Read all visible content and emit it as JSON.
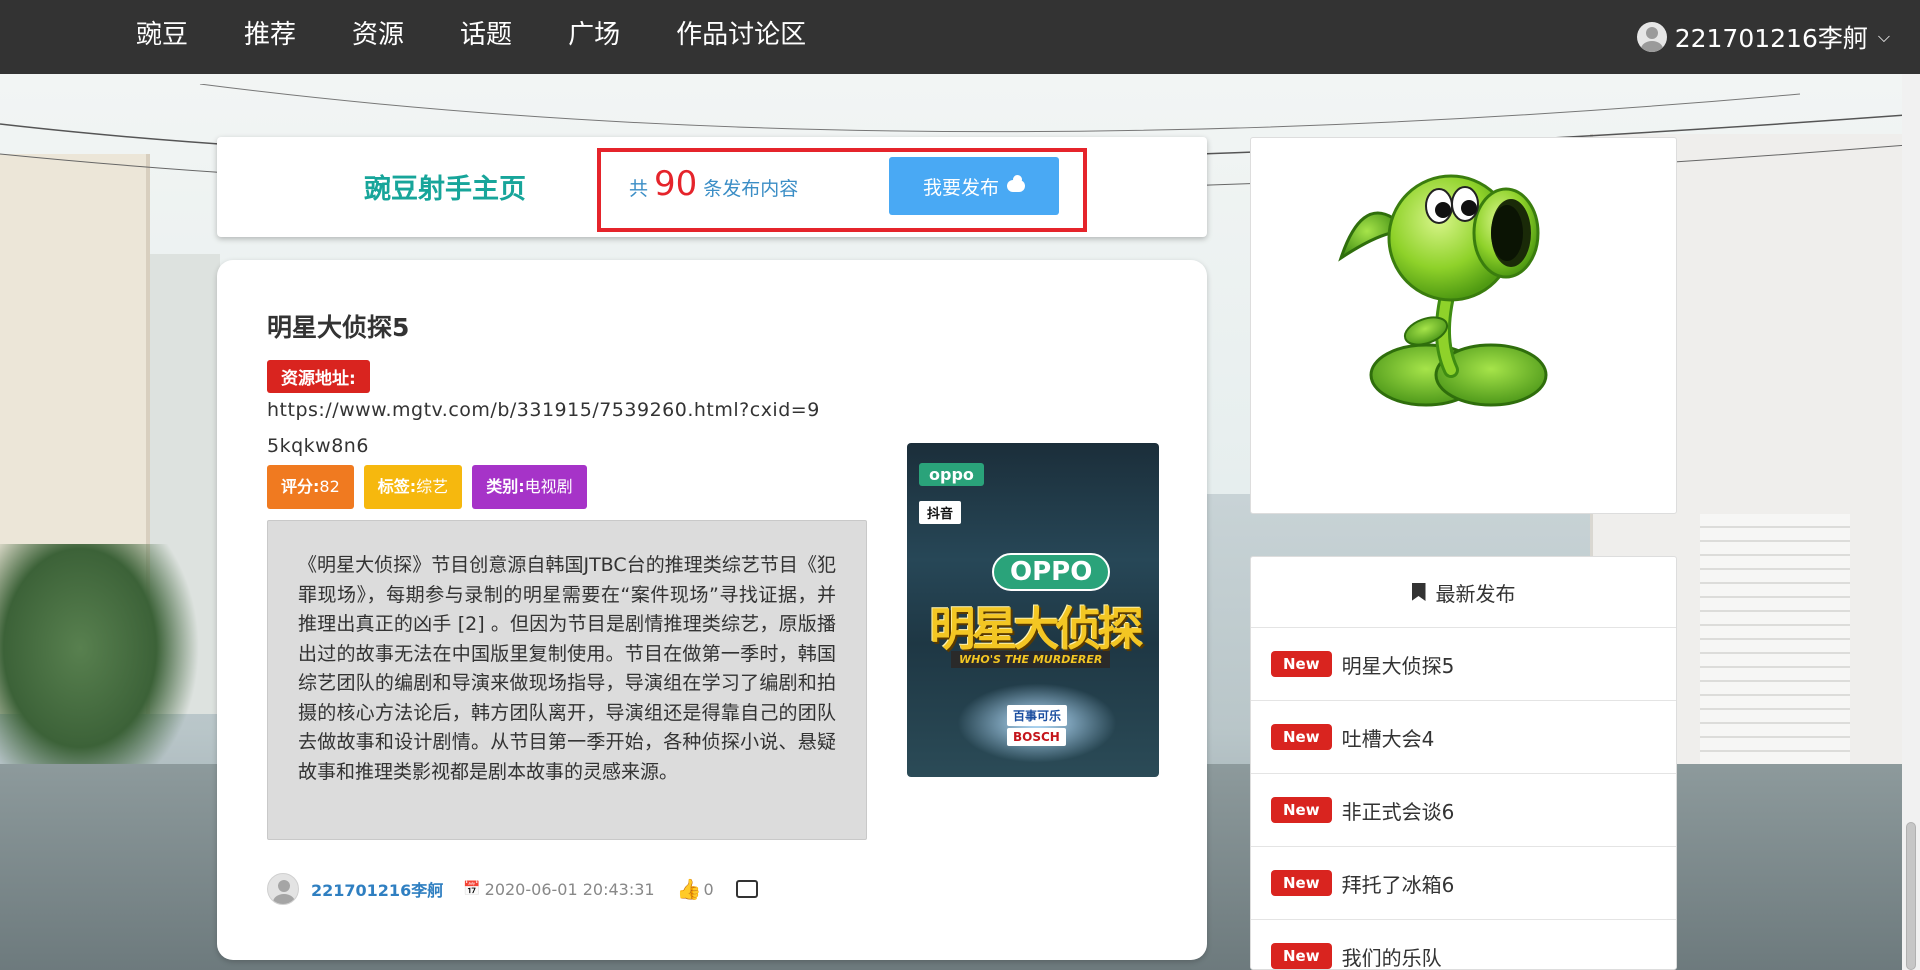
{
  "nav": {
    "items": [
      "豌豆",
      "推荐",
      "资源",
      "话题",
      "广场",
      "作品讨论区"
    ],
    "user_name": "221701216李舸"
  },
  "header": {
    "title": "豌豆射手主页",
    "count_prefix": "共",
    "count": "90",
    "count_suffix": "条发布内容",
    "publish_label": "我要发布"
  },
  "post": {
    "title": "明星大侦探5",
    "resource_label": "资源地址:",
    "resource_url": "https://www.mgtv.com/b/331915/7539260.html?cxid=95kqkw8n6",
    "tags": [
      {
        "key": "评分:",
        "value": "82",
        "color": "#f07a20"
      },
      {
        "key": "标签:",
        "value": "综艺",
        "color": "#f6b80e"
      },
      {
        "key": "类别:",
        "value": "电视剧",
        "color": "#a633c8"
      }
    ],
    "description": "《明星大侦探》节目创意源自韩国JTBC台的推理类综艺节目《犯罪现场》，每期参与录制的明星需要在“案件现场”寻找证据，并推理出真正的凶手 [2] 。但因为节目是剧情推理类综艺，原版播出过的故事无法在中国版里复制使用。节目在做第一季时，韩国综艺团队的编剧和导演来做现场指导，导演组在学习了编剧和拍摄的核心方法论后，韩方团队离开，导演组还是得靠自己的团队去做故事和设计剧情。从节目第一季开始，各种侦探小说、悬疑故事和推理类影视都是剧本故事的灵感来源。",
    "poster": {
      "oppo_small": "oppo",
      "tiktok": "抖音",
      "oppo_big": "OPPO",
      "big_title": "明星大侦探",
      "subtitle": "WHO'S THE MURDERER",
      "sponsor1": "百事可乐",
      "sponsor2": "BOSCH"
    },
    "author": "221701216李舸",
    "time": "2020-06-01 20:43:31",
    "likes": "0"
  },
  "latest": {
    "title": "最新发布",
    "badge": "New",
    "items": [
      "明星大侦探5",
      "吐槽大会4",
      "非正式会谈6",
      "拜托了冰箱6",
      "我们的乐队"
    ]
  },
  "icons": {
    "user": "user-avatar-icon",
    "caret": "chevron-down-icon",
    "publish": "cloud-upload-icon",
    "calendar": "calendar-icon",
    "like": "thumbs-up-icon",
    "comment": "comment-icon",
    "bookmark": "bookmark-icon"
  },
  "colors": {
    "topbar": "#333333",
    "brand_teal": "#17a59a",
    "accent_red": "#e5242b",
    "button_blue": "#49a9f4",
    "link_blue": "#2f7fc1"
  }
}
